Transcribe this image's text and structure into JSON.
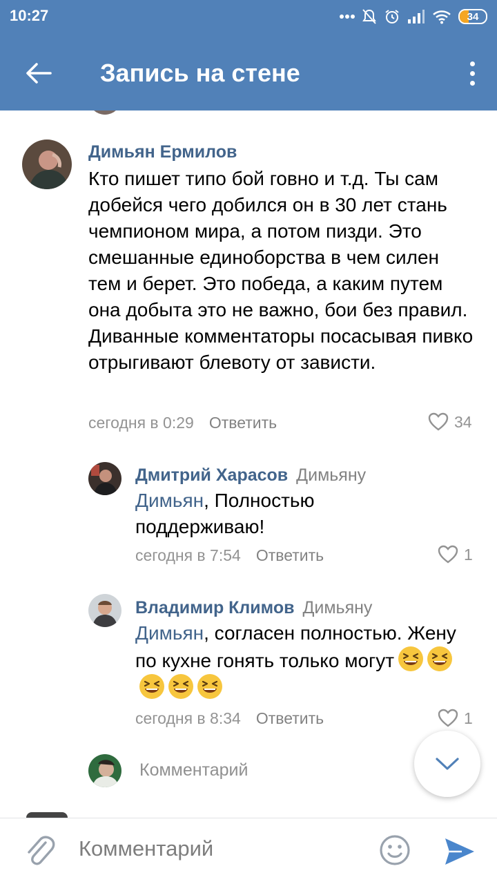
{
  "status_bar": {
    "time": "10:27",
    "battery": "34",
    "battery_level": 0.34,
    "icons": [
      "dots-icon",
      "mute-icon",
      "alarm-icon",
      "signal-icon",
      "wifi-icon",
      "battery-icon"
    ]
  },
  "header": {
    "title": "Запись на стене",
    "back_icon": "arrow-left-icon",
    "menu_icon": "more-vertical-icon"
  },
  "comments": [
    {
      "author": "Димьян Ермилов",
      "text": "Кто пишет типо бой говно и т.д. Ты сам добейся чего добился он в 30 лет стань чемпионом мира, а потом пизди. Это смешанные единоборства в чем силен тем и берет. Это победа, а каким путем она добыта это не важно, бои без правил. Диванные комментаторы посасывая пивко отрыгивают блевоту от зависти.",
      "time": "сегодня в 0:29",
      "reply_label": "Ответить",
      "likes": "34"
    },
    {
      "author": "Дмитрий Харасов",
      "reply_to": "Димьяну",
      "mention": "Димьян",
      "text": ", Полностью поддерживаю!",
      "time": "сегодня в 7:54",
      "reply_label": "Ответить",
      "likes": "1"
    },
    {
      "author": "Владимир Климов",
      "reply_to": "Димьяну",
      "mention": "Димьян",
      "text": ", согласен полностью. Жену по кухне гонять только могут",
      "emoji_count": 5,
      "emoji": "grinning-squinting-face",
      "time": "сегодня в 8:34",
      "reply_label": "Ответить",
      "likes": "1"
    }
  ],
  "reply_field": {
    "placeholder": "Комментарий"
  },
  "composer": {
    "placeholder": "Комментарий",
    "attach_icon": "paperclip-icon",
    "emoji_icon": "smile-icon",
    "send_icon": "send-icon"
  },
  "scroll_button_icon": "chevron-down-icon",
  "colors": {
    "header": "#5181b8",
    "link": "#42648b",
    "meta": "#939393",
    "accent": "#4a86cc"
  }
}
